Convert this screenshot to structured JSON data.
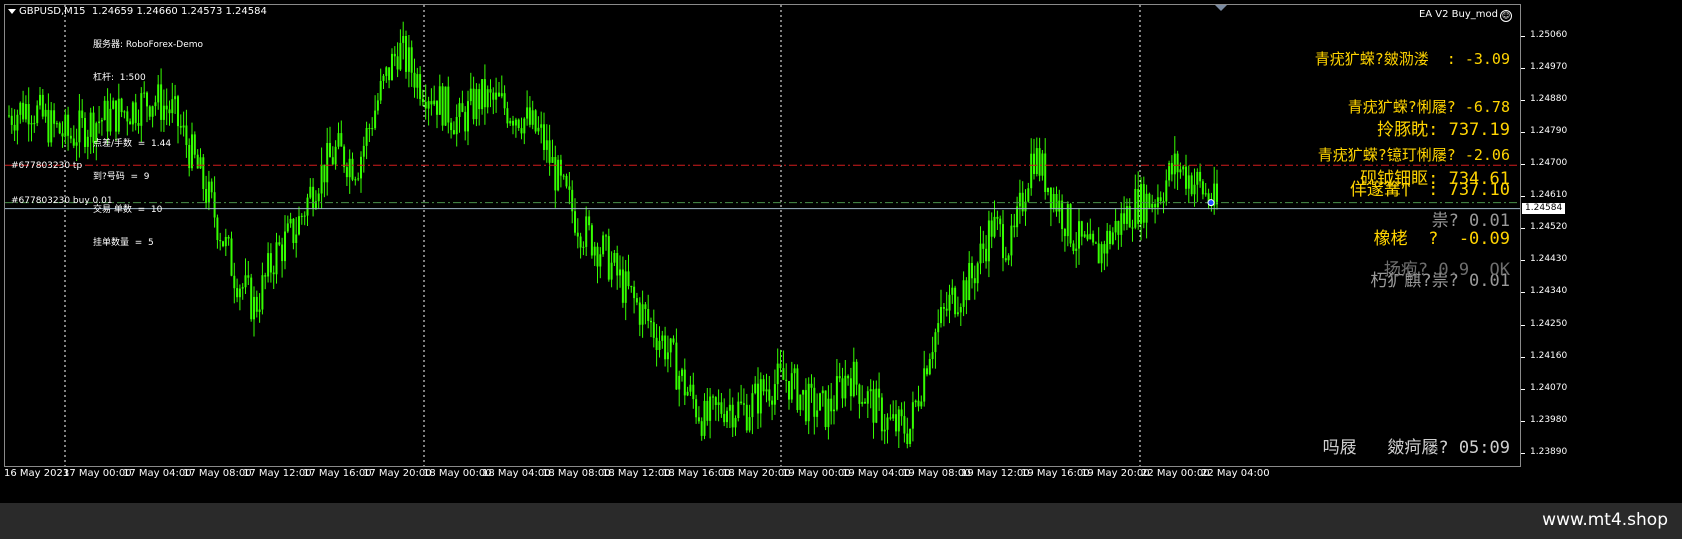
{
  "header": {
    "symbol": "GBPUSD,M15",
    "ohlc": "1.24659 1.24660 1.24573 1.24584"
  },
  "info": {
    "server": "服务器: RoboForex-Demo",
    "leverage": "杠杆:  1:500",
    "l1": "点差/手数  =  1.44",
    "l2": "到?号码  =  9",
    "l3": "交易 单数  =  10",
    "l4": "挂单数量  =  5"
  },
  "ea": {
    "name": "EA V2 Buy_mod",
    "smiley": "☺"
  },
  "panel": {
    "p1": "青疣犷蝾?皴泐溇  : -3.09",
    "p2": "青疣犷蝾?悧屦? -6.78",
    "p3": "青疣犷蝾?镱玎悧屦? -2.06",
    "p4": "拎豚眈: 737.19",
    "p5": "佯邃篝忄 : 737.10",
    "p6": "砚钺钿眍: 734.61",
    "p7": "橡栳  ?  -0.09",
    "p8": "祟? 0.01",
    "p9": "朽犷麒?祟? 0.01",
    "p10": "扬疱? 0.9  OK",
    "bottom": "吗屐   皴疴屦? 05:09"
  },
  "lines": {
    "tp_label": "#677803230 tp",
    "buy_label": "#677803230 buy 0.01",
    "tp_color": "#d11c1c",
    "buy_color": "#4a8f4a",
    "bid_color": "#9fb7c9"
  },
  "colors": {
    "candle": "#35ff00",
    "grid": "#ffffff",
    "text_yellow": "#ffd400"
  },
  "current_price_label": "1.24584",
  "site": "www.mt4.shop",
  "chart_data": {
    "type": "candlestick",
    "symbol": "GBPUSD",
    "timeframe": "M15",
    "ylim": [
      1.2385,
      1.2515
    ],
    "y_ticks": [
      "1.25060",
      "1.24970",
      "1.24880",
      "1.24790",
      "1.24700",
      "1.24610",
      "1.24520",
      "1.24430",
      "1.24340",
      "1.24250",
      "1.24160",
      "1.24070",
      "1.23980",
      "1.23890"
    ],
    "x_ticks": [
      "16 May 2023",
      "17 May 00:00",
      "17 May 04:00",
      "17 May 08:00",
      "17 May 12:00",
      "17 May 16:00",
      "17 May 20:00",
      "18 May 00:00",
      "18 May 04:00",
      "18 May 08:00",
      "18 May 12:00",
      "18 May 16:00",
      "18 May 20:00",
      "19 May 00:00",
      "19 May 04:00",
      "19 May 08:00",
      "19 May 12:00",
      "19 May 16:00",
      "19 May 20:00",
      "22 May 00:00",
      "22 May 04:00"
    ],
    "levels": {
      "tp": 1.247,
      "buy": 1.24595,
      "bid": 1.24584
    },
    "close_path": [
      1.2484,
      1.2487,
      1.2481,
      1.2478,
      1.2482,
      1.2484,
      1.2486,
      1.2489,
      1.2485,
      1.2472,
      1.2457,
      1.244,
      1.243,
      1.2445,
      1.2452,
      1.2466,
      1.2474,
      1.247,
      1.2488,
      1.2503,
      1.2494,
      1.2488,
      1.2482,
      1.2489,
      1.2487,
      1.2484,
      1.2478,
      1.2463,
      1.2452,
      1.2446,
      1.2436,
      1.2428,
      1.242,
      1.2408,
      1.2398,
      1.2403,
      1.2401,
      1.2408,
      1.241,
      1.2403,
      1.2401,
      1.2412,
      1.2404,
      1.2397,
      1.2396,
      1.242,
      1.2432,
      1.2438,
      1.2453,
      1.2447,
      1.2474,
      1.2462,
      1.245,
      1.2444,
      1.2452,
      1.2459,
      1.2461,
      1.247,
      1.2465,
      1.2458
    ]
  }
}
